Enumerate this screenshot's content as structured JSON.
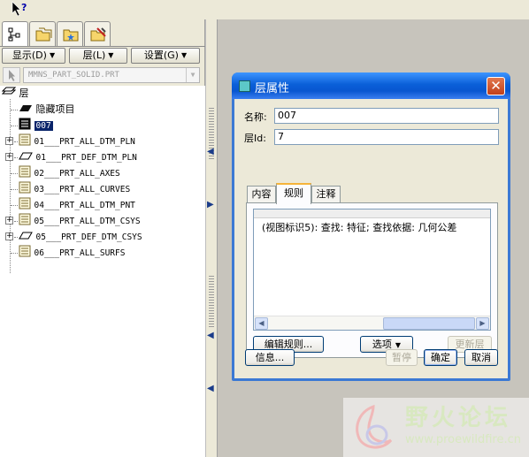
{
  "navigator": {
    "tabs": [
      {
        "name": "model-tree-tab",
        "active": true
      },
      {
        "name": "folder-browser-tab",
        "active": false
      },
      {
        "name": "favorites-tab",
        "active": false
      },
      {
        "name": "connections-tab",
        "active": false
      }
    ],
    "buttons": {
      "show": "显示(D)",
      "layer": "层(L)",
      "settings": "设置(G)"
    },
    "model_combo": "MMNS_PART_SOLID.PRT",
    "tree": {
      "root": "层",
      "items": [
        {
          "label": "隐藏项目",
          "icon": "hidden-items-icon"
        },
        {
          "label": "007",
          "icon": "layer-icon",
          "selected": true
        },
        {
          "label": "01___PRT_ALL_DTM_PLN",
          "icon": "layer-icon",
          "expandable": true
        },
        {
          "label": "01___PRT_DEF_DTM_PLN",
          "icon": "plane-layer-icon",
          "expandable": true
        },
        {
          "label": "02___PRT_ALL_AXES",
          "icon": "layer-icon"
        },
        {
          "label": "03___PRT_ALL_CURVES",
          "icon": "layer-icon"
        },
        {
          "label": "04___PRT_ALL_DTM_PNT",
          "icon": "layer-icon"
        },
        {
          "label": "05___PRT_ALL_DTM_CSYS",
          "icon": "layer-icon",
          "expandable": true
        },
        {
          "label": "05___PRT_DEF_DTM_CSYS",
          "icon": "plane-layer-icon",
          "expandable": true
        },
        {
          "label": "06___PRT_ALL_SURFS",
          "icon": "layer-icon"
        }
      ]
    }
  },
  "dialog": {
    "title": "层属性",
    "name_label": "名称:",
    "name_value": "007",
    "id_label": "层Id:",
    "id_value": "7",
    "tabs": [
      "内容",
      "规则",
      "注释"
    ],
    "active_tab": "规则",
    "rule_text": "(视图标识5): 查找: 特征; 查找依据: 几何公差",
    "buttons": {
      "edit_rules": "编辑规则...",
      "options": "选项",
      "update_layer": "更新层",
      "info": "信息...",
      "pause": "暂停",
      "ok": "确定",
      "cancel": "取消"
    }
  },
  "watermark": {
    "title": "野火论坛",
    "url": "www.proewildfire.cn"
  },
  "colors": {
    "title_bar": "#0a5fd8",
    "selection": "#0a246a",
    "graphics_bg": "#c7c4bc"
  }
}
